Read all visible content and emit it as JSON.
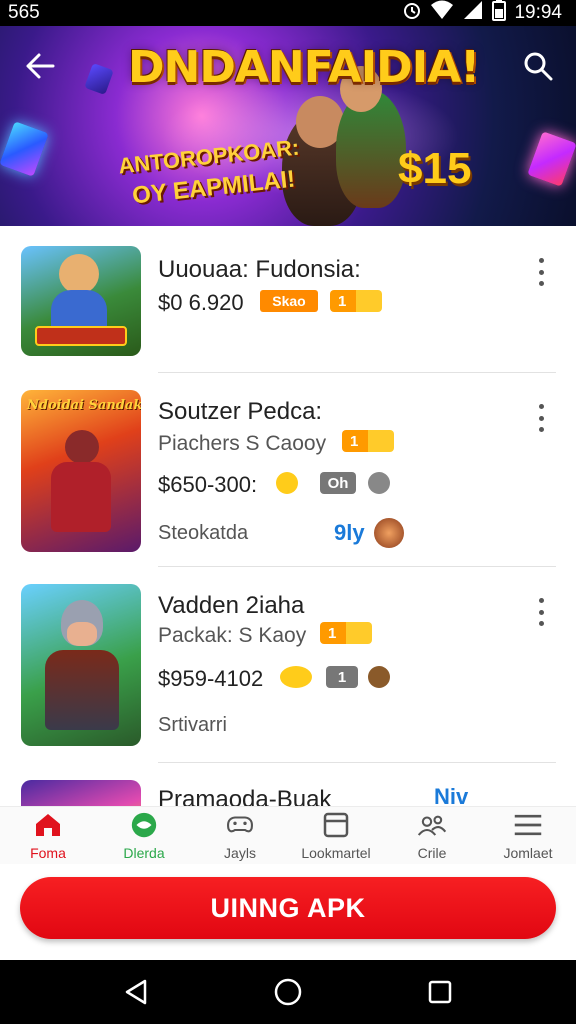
{
  "status_bar": {
    "left": "565",
    "time": "19:94"
  },
  "banner": {
    "title": "DNDANFAIDIA!",
    "subtitle_line1": "ANTOROPKOAR:",
    "subtitle_line2": "OY EAPMILAI!",
    "price": "$15"
  },
  "items": [
    {
      "title": "Uuouaa: Fudonsia:",
      "price": "$0 6.920",
      "badge": "Skao",
      "badge2": "1"
    },
    {
      "thumb_label": "Ndoidai Sandak",
      "title": "Soutzer Pedca:",
      "subtitle": "Piachers S Caooy",
      "badge": "1",
      "price": "$650-300:",
      "chip": "Oh",
      "footer": "Steokatda",
      "tag": "9ly"
    },
    {
      "title": "Vadden 2iaha",
      "subtitle": "Packak: S Kaoy",
      "badge": "1",
      "price": "$959-4102",
      "chip": "1",
      "footer": "Srtivarri"
    },
    {
      "title": "Pramaoda-Buak",
      "tag": "Niv"
    }
  ],
  "bottom_nav": [
    {
      "label": "Foma",
      "icon": "home-icon"
    },
    {
      "label": "Dlerda",
      "icon": "gamepad-icon"
    },
    {
      "label": "Jayls",
      "icon": "controller-icon"
    },
    {
      "label": "Lookmartel",
      "icon": "tablet-icon"
    },
    {
      "label": "Crile",
      "icon": "people-icon"
    },
    {
      "label": "Jomlaet",
      "icon": "menu-icon"
    }
  ],
  "cta_label": "UINNG APK",
  "colors": {
    "accent_red": "#e10712",
    "brand_green": "#2ba84a",
    "badge_orange": "#ff8a00"
  }
}
